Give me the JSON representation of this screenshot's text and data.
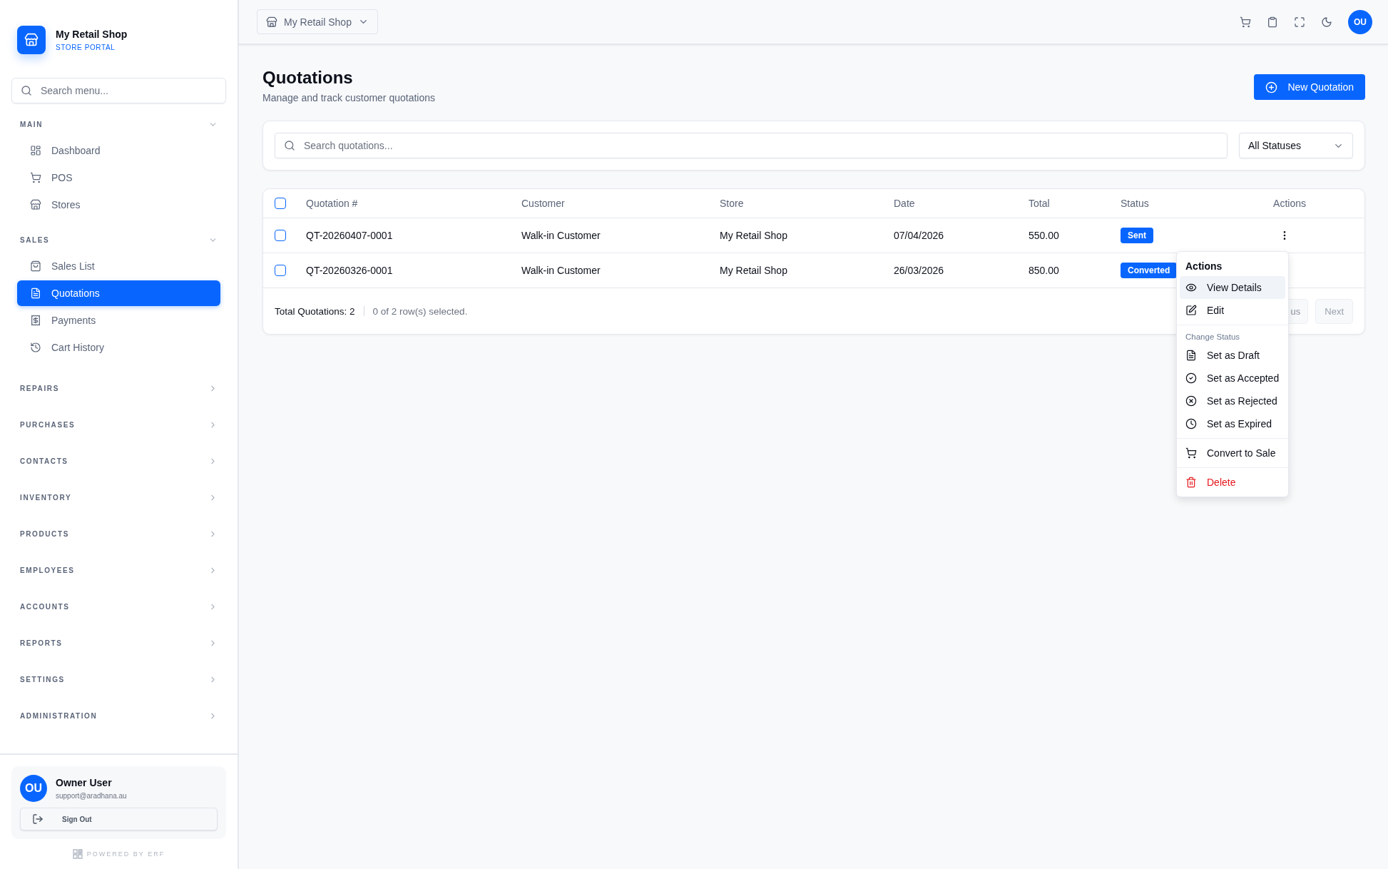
{
  "brand": {
    "title": "My Retail Shop",
    "subtitle": "STORE PORTAL"
  },
  "sidebar_search": {
    "placeholder": "Search menu..."
  },
  "sidebar": [
    {
      "label": "MAIN",
      "expanded": true,
      "items": [
        {
          "label": "Dashboard",
          "kind": "dashboard",
          "selected": false
        },
        {
          "label": "POS",
          "kind": "cart",
          "selected": false
        },
        {
          "label": "Stores",
          "kind": "store",
          "selected": false
        }
      ]
    },
    {
      "label": "SALES",
      "expanded": true,
      "items": [
        {
          "label": "Sales List",
          "kind": "bag",
          "selected": false
        },
        {
          "label": "Quotations",
          "kind": "document",
          "selected": true
        },
        {
          "label": "Payments",
          "kind": "receipt",
          "selected": false
        },
        {
          "label": "Cart History",
          "kind": "history",
          "selected": false
        }
      ]
    },
    {
      "label": "REPAIRS",
      "expanded": false
    },
    {
      "label": "PURCHASES",
      "expanded": false
    },
    {
      "label": "CONTACTS",
      "expanded": false
    },
    {
      "label": "INVENTORY",
      "expanded": false
    },
    {
      "label": "PRODUCTS",
      "expanded": false
    },
    {
      "label": "EMPLOYEES",
      "expanded": false
    },
    {
      "label": "ACCOUNTS",
      "expanded": false
    },
    {
      "label": "REPORTS",
      "expanded": false
    },
    {
      "label": "SETTINGS",
      "expanded": false
    },
    {
      "label": "ADMINISTRATION",
      "expanded": false
    }
  ],
  "user": {
    "initials": "OU",
    "name": "Owner User",
    "email": "support@aradhana.au",
    "sign_out": "Sign Out"
  },
  "powered_by": "POWERED BY ERF",
  "topbar": {
    "store": "My Retail Shop",
    "avatar": "OU"
  },
  "page": {
    "title": "Quotations",
    "subtitle": "Manage and track customer quotations",
    "new_button": "New Quotation"
  },
  "filters": {
    "search_placeholder": "Search quotations...",
    "status": "All Statuses"
  },
  "table": {
    "columns": [
      "Quotation #",
      "Customer",
      "Store",
      "Date",
      "Total",
      "Status",
      "Actions"
    ],
    "all_checked": false,
    "rows": [
      {
        "number": "QT-20260407-0001",
        "customer": "Walk-in Customer",
        "store": "My Retail Shop",
        "date": "07/04/2026",
        "total": "550.00",
        "status": "Sent",
        "checked": false,
        "menu_open": true
      },
      {
        "number": "QT-20260326-0001",
        "customer": "Walk-in Customer",
        "store": "My Retail Shop",
        "date": "26/03/2026",
        "total": "850.00",
        "status": "Converted",
        "checked": false,
        "menu_open": false
      }
    ],
    "total": "Total Quotations: 2",
    "selected_info": "0 of 2 row(s) selected.",
    "previous": "us",
    "next": "Next"
  },
  "menu": {
    "title": "Actions",
    "groups": [
      {
        "items": [
          {
            "label": "View Details",
            "kind": "eye",
            "selected": true
          },
          {
            "label": "Edit",
            "kind": "edit",
            "selected": false
          }
        ]
      },
      {
        "heading": "Change Status",
        "items": [
          {
            "label": "Set as Draft",
            "kind": "document",
            "selected": false
          },
          {
            "label": "Set as Accepted",
            "kind": "check",
            "selected": false
          },
          {
            "label": "Set as Rejected",
            "kind": "reject",
            "selected": false
          },
          {
            "label": "Set as Expired",
            "kind": "clock",
            "selected": false
          }
        ]
      },
      {
        "items": [
          {
            "label": "Convert to Sale",
            "kind": "cart",
            "selected": false
          }
        ]
      },
      {
        "items": [
          {
            "label": "Delete",
            "kind": "delete",
            "selected": false
          }
        ]
      }
    ]
  }
}
